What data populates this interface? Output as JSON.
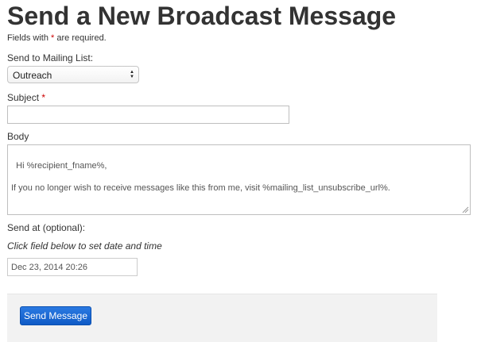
{
  "page": {
    "title": "Send a New Broadcast Message"
  },
  "required_note": {
    "prefix": "Fields with ",
    "star": "*",
    "suffix": " are required."
  },
  "mailing_list": {
    "label": "Send to Mailing List:",
    "selected": "Outreach"
  },
  "subject": {
    "label": "Subject",
    "required_mark": "*",
    "value": ""
  },
  "body": {
    "label": "Body",
    "value": "Hi %recipient_fname%,\n\nIf you no longer wish to receive messages like this from me, visit %mailing_list_unsubscribe_url%."
  },
  "send_at": {
    "label": "Send at (optional):",
    "hint": "Click field below to set date and time",
    "value": "Dec 23, 2014 20:26"
  },
  "actions": {
    "send_label": "Send Message"
  },
  "colors": {
    "accent": "#1565d0",
    "required": "#cc0000",
    "action_bar_bg": "#f2f2f2"
  }
}
